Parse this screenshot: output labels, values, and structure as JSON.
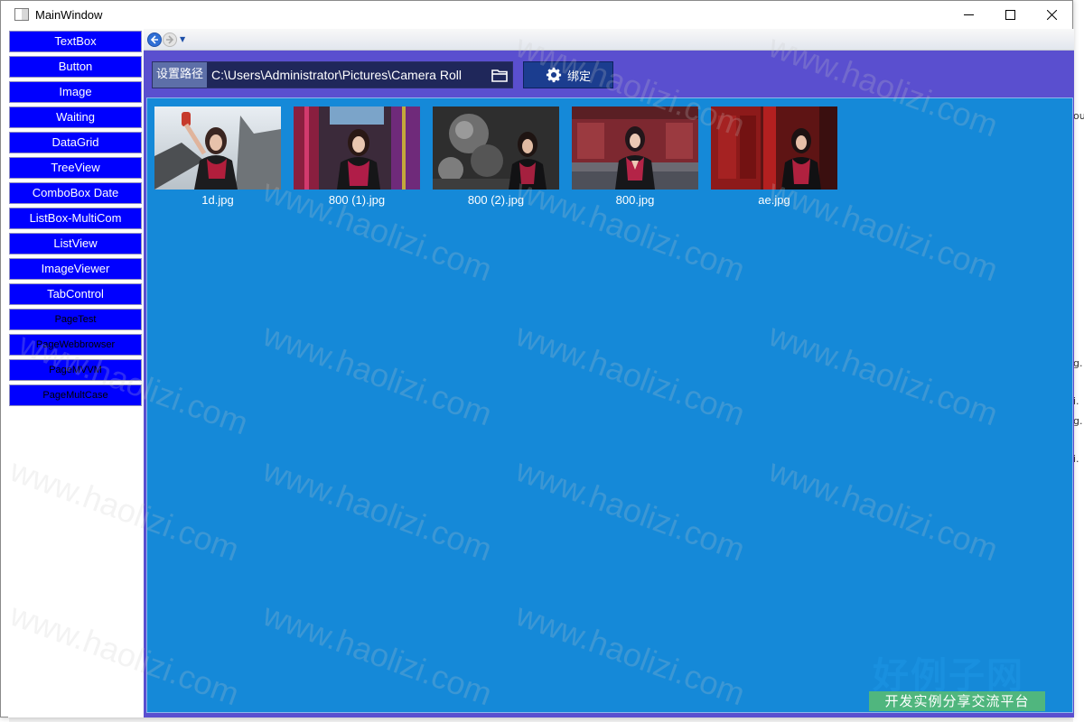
{
  "window": {
    "title": "MainWindow",
    "controls": {
      "minimize": "—",
      "maximize": "☐",
      "close": "✕"
    }
  },
  "nav": {
    "items": [
      {
        "label": "TextBox",
        "kind": "button"
      },
      {
        "label": "Button",
        "kind": "button"
      },
      {
        "label": "Image",
        "kind": "button"
      },
      {
        "label": "Waiting",
        "kind": "button"
      },
      {
        "label": "DataGrid",
        "kind": "button"
      },
      {
        "label": "TreeView",
        "kind": "button"
      },
      {
        "label": "ComboBox Date",
        "kind": "button"
      },
      {
        "label": "ListBox-MultiCom",
        "kind": "button"
      },
      {
        "label": "ListView",
        "kind": "button"
      },
      {
        "label": "ImageViewer",
        "kind": "button"
      },
      {
        "label": "TabControl",
        "kind": "button"
      },
      {
        "label": "PageTest",
        "kind": "link"
      },
      {
        "label": "PageWebbrowser",
        "kind": "link"
      },
      {
        "label": "PageMVVM",
        "kind": "link"
      },
      {
        "label": "PageMultCase",
        "kind": "link"
      }
    ]
  },
  "toolbar": {
    "path_label": "设置路径",
    "path_value": "C:\\Users\\Administrator\\Pictures\\Camera Roll",
    "bind_label": "绑定"
  },
  "images": [
    {
      "name": "1d.jpg"
    },
    {
      "name": "800 (1).jpg"
    },
    {
      "name": "800 (2).jpg"
    },
    {
      "name": "800.jpg"
    },
    {
      "name": "ae.jpg"
    }
  ],
  "watermark": {
    "text": "www.haolizi.com",
    "brand_main": "好例子网",
    "brand_sub": "开发实例分享交流平台"
  },
  "colors": {
    "nav_button": "#0000ff",
    "frame_bg": "#5a4fcf",
    "list_bg": "#1589d8",
    "path_box": "#1f275a",
    "bind_button": "#1b3d8f"
  }
}
